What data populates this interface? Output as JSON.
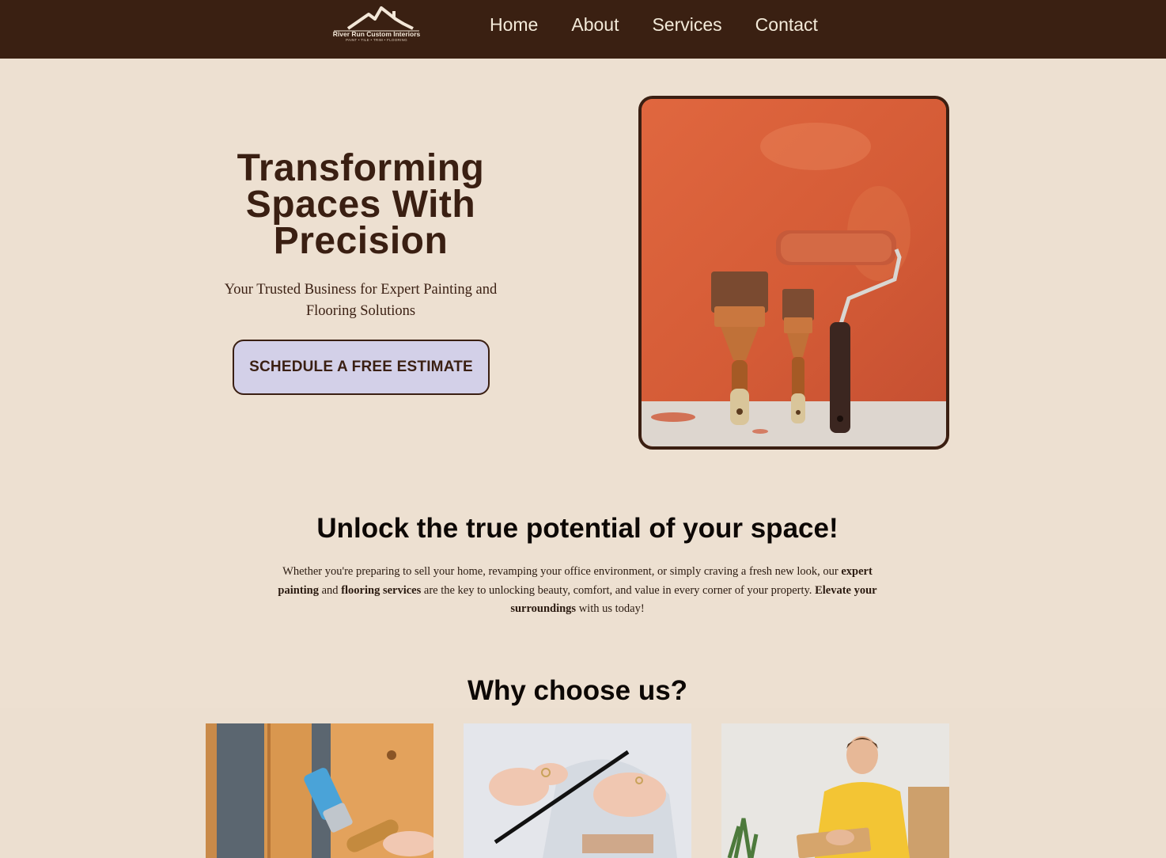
{
  "nav": {
    "logo": {
      "brand": "River Run Custom Interiors",
      "tagline": "PAINT • TILE • TRIM • FLOORING"
    },
    "links": [
      "Home",
      "About",
      "Services",
      "Contact"
    ]
  },
  "hero": {
    "title_lines": [
      "Transforming",
      "Spaces With",
      "Precision"
    ],
    "subtitle_line1": "Your Trusted Business for Expert Painting and",
    "subtitle_line2": "Flooring Solutions",
    "cta_label": "SCHEDULE A FREE ESTIMATE",
    "image_icon": "paintbrushes-roller-image"
  },
  "unlock": {
    "title": "Unlock the true potential of your space!",
    "text_1": "Whether you're preparing to sell your home, revamping your office environment, or simply craving a fresh new look, our",
    "bold_1": "expert painting",
    "text_2": "and",
    "bold_2": "flooring services",
    "text_3": "are the key to unlocking beauty, comfort, and value in every corner of your property.",
    "bold_3": "Elevate your surroundings",
    "text_4": "with us today!"
  },
  "why": {
    "title": "Why choose us?",
    "cards": [
      "brush-staining-wood-image",
      "hands-measuring-plan-image",
      "man-with-clipboard-image"
    ]
  },
  "colors": {
    "nav_bg": "#3a2012",
    "page_bg": "#ede0d1",
    "text_dark": "#3a1f12",
    "cta_bg": "#d3d0e8",
    "wall_orange": "#d7603d"
  }
}
